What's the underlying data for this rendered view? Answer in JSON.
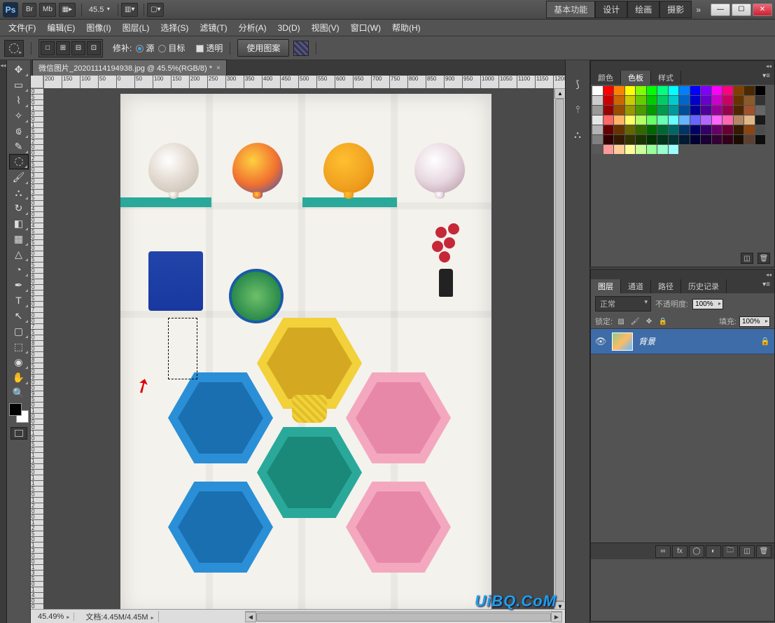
{
  "titlebar": {
    "app": "Ps",
    "buttons": [
      "Br",
      "Mb"
    ],
    "zoom": "45.5",
    "workspaces": [
      "基本功能",
      "设计",
      "绘画",
      "摄影"
    ],
    "more": "»"
  },
  "menu": [
    "文件(F)",
    "编辑(E)",
    "图像(I)",
    "图层(L)",
    "选择(S)",
    "滤镜(T)",
    "分析(A)",
    "3D(D)",
    "视图(V)",
    "窗口(W)",
    "帮助(H)"
  ],
  "options": {
    "patch_label": "修补:",
    "source": "源",
    "dest": "目标",
    "transparent": "透明",
    "use_pattern": "使用图案"
  },
  "document": {
    "tab_title": "微信图片_20201114194938.jpg @ 45.5%(RGB/8) *"
  },
  "ruler_h": [
    "200",
    "150",
    "100",
    "50",
    "0",
    "50",
    "100",
    "150",
    "200",
    "250",
    "300",
    "350",
    "400",
    "450",
    "500",
    "550",
    "600",
    "650",
    "700",
    "750",
    "800",
    "850",
    "900",
    "950",
    "1000",
    "1050",
    "1100",
    "1150",
    "1200"
  ],
  "ruler_v": [
    "0",
    "5",
    "0",
    "1",
    "0",
    "0",
    "1",
    "5",
    "0",
    "2",
    "0",
    "0",
    "2",
    "5",
    "0",
    "3",
    "0",
    "0",
    "3",
    "5",
    "0",
    "4",
    "0",
    "0",
    "4",
    "5",
    "0",
    "5",
    "0",
    "0",
    "5",
    "5",
    "0",
    "6",
    "0",
    "0",
    "6",
    "5",
    "0",
    "7",
    "0",
    "0",
    "7",
    "5",
    "0",
    "8",
    "0",
    "0",
    "8",
    "5",
    "0",
    "9",
    "0",
    "0",
    "9",
    "5",
    "0",
    "1",
    "0",
    "0",
    "0",
    "1",
    "0",
    "5",
    "0",
    "1",
    "1",
    "0",
    "0",
    "1",
    "1",
    "5",
    "0",
    "1",
    "2",
    "0",
    "0",
    "1",
    "2",
    "5",
    "0",
    "1",
    "3",
    "0",
    "0",
    "1",
    "3",
    "5",
    "0",
    "1",
    "4",
    "0",
    "0"
  ],
  "status": {
    "zoom": "45.49%",
    "doc": "文档:4.45M/4.45M"
  },
  "panels": {
    "swatches_tabs": [
      "颜色",
      "色板",
      "样式"
    ],
    "layers_tabs": [
      "图层",
      "通道",
      "路径",
      "历史记录"
    ],
    "blend_mode": "正常",
    "opacity_label": "不透明度:",
    "opacity": "100%",
    "lock_label": "锁定:",
    "fill_label": "填充:",
    "fill": "100%",
    "layer_name": "背景"
  },
  "swatch_colors": [
    "#ffffff",
    "#ff0000",
    "#ff8000",
    "#ffff00",
    "#80ff00",
    "#00ff00",
    "#00ff80",
    "#00ffff",
    "#0080ff",
    "#0000ff",
    "#8000ff",
    "#ff00ff",
    "#ff0080",
    "#804000",
    "#4a2a00",
    "#000000",
    "#cccccc",
    "#cc0000",
    "#cc6600",
    "#cccc00",
    "#66cc00",
    "#00cc00",
    "#00cc66",
    "#00cccc",
    "#0066cc",
    "#0000cc",
    "#6600cc",
    "#cc00cc",
    "#cc0066",
    "#663300",
    "#8b5a2b",
    "#333333",
    "#999999",
    "#990000",
    "#994d00",
    "#999900",
    "#4d9900",
    "#009900",
    "#00994d",
    "#009999",
    "#004d99",
    "#000099",
    "#4d0099",
    "#990099",
    "#99004d",
    "#4d2600",
    "#a0522d",
    "#666666",
    "#e6e6e6",
    "#ff6666",
    "#ffb366",
    "#ffff66",
    "#b3ff66",
    "#66ff66",
    "#66ffb3",
    "#66ffff",
    "#66b3ff",
    "#6666ff",
    "#b366ff",
    "#ff66ff",
    "#ff66b3",
    "#b38666",
    "#deb887",
    "#1a1a1a",
    "#b3b3b3",
    "#660000",
    "#663300",
    "#666600",
    "#336600",
    "#006600",
    "#006633",
    "#006666",
    "#003366",
    "#000066",
    "#330066",
    "#660066",
    "#660033",
    "#331a00",
    "#8b4513",
    "#4d4d4d",
    "#808080",
    "#330000",
    "#331a00",
    "#333300",
    "#1a3300",
    "#003300",
    "#00331a",
    "#003333",
    "#001a33",
    "#000033",
    "#1a0033",
    "#330033",
    "#33001a",
    "#1a0d00",
    "#5c4033",
    "#0d0d0d",
    "#595959",
    "#ff9999",
    "#ffcc99",
    "#ffff99",
    "#ccff99",
    "#99ff99",
    "#99ffcc",
    "#99ffff"
  ],
  "watermark": "UiBQ.CoM"
}
